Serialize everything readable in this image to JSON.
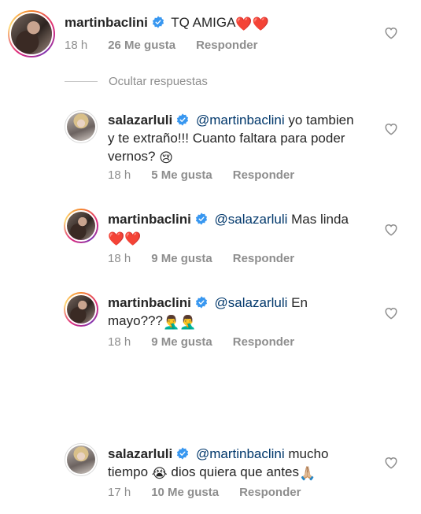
{
  "comments": [
    {
      "username": "martinbaclini",
      "text_line1": "TQ AMIGA",
      "emoji_line1": "❤️❤️",
      "time": "18 h",
      "likes": "26 Me gusta",
      "reply": "Responder"
    },
    {
      "username": "salazarluli",
      "mention": "@martinbaclini",
      "text_line1": "yo tambien",
      "text_line2": "y te extraño!!! Cuanto faltara para poder",
      "text_line3": "vernos?",
      "emoji_line3": "😢",
      "time": "18 h",
      "likes": "5 Me gusta",
      "reply": "Responder"
    },
    {
      "username": "martinbaclini",
      "mention": "@salazarluli",
      "text_line1": "Mas linda",
      "emoji_line2": "❤️❤️",
      "time": "18 h",
      "likes": "9 Me gusta",
      "reply": "Responder"
    },
    {
      "username": "martinbaclini",
      "mention": "@salazarluli",
      "text_line1": "En",
      "text_line2": "mayo???",
      "emoji_line2": "🤦‍♂️🤦‍♂️",
      "time": "18 h",
      "likes": "9 Me gusta",
      "reply": "Responder"
    },
    {
      "username": "salazarluli",
      "mention": "@martinbaclini",
      "text_line1": "mucho",
      "text_line2a": "tiempo",
      "emoji_line2a": "😭",
      "text_line2b": "dios quiera que antes",
      "emoji_line2b": "🙏🏼",
      "time": "17 h",
      "likes": "10 Me gusta",
      "reply": "Responder"
    }
  ],
  "hide_replies_label": "Ocultar respuestas",
  "colors": {
    "text": "#262626",
    "meta": "#8e8e8e",
    "mention": "#00376b",
    "verified": "#3897f0"
  }
}
